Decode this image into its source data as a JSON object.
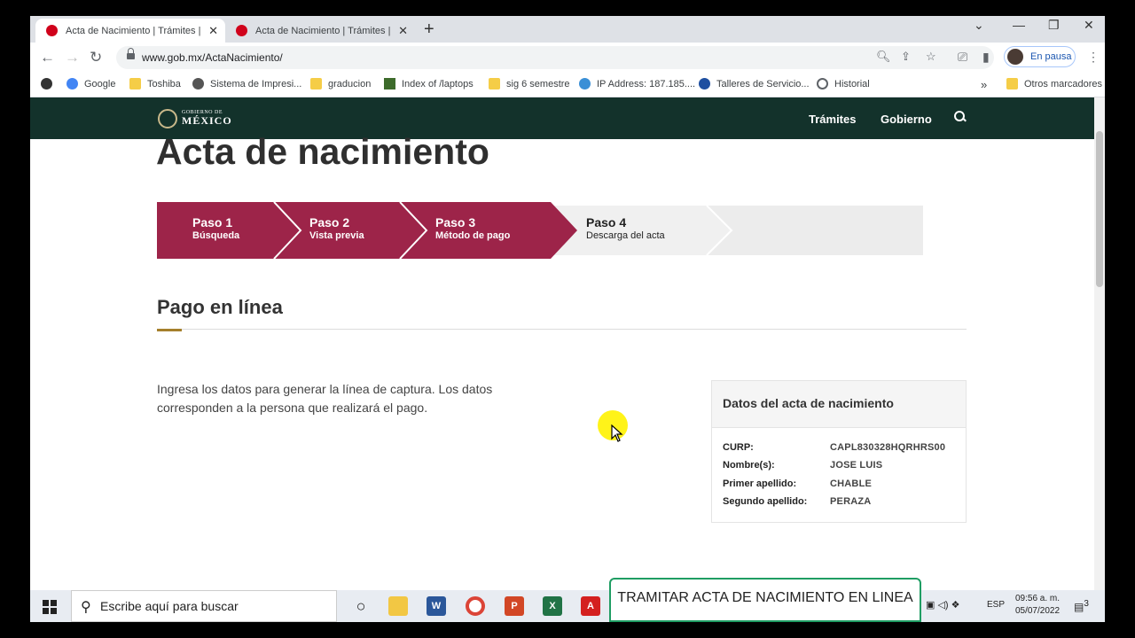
{
  "browser": {
    "tabs": [
      {
        "title": "Acta de Nacimiento | Trámites | g",
        "active": true
      },
      {
        "title": "Acta de Nacimiento | Trámites | g",
        "active": false
      }
    ],
    "url": "www.gob.mx/ActaNacimiento/",
    "profile_label": "En pausa",
    "bookmarks": [
      "Google",
      "Toshiba",
      "Sistema de Impresi...",
      "graducion",
      "Index of /laptops",
      "sig 6 semestre",
      "IP Address: 187.185....",
      "Talleres de Servicio...",
      "Historial"
    ],
    "other_bookmarks": "Otros marcadores",
    "more_chevron": "»"
  },
  "site": {
    "logo_top": "GOBIERNO DE",
    "logo_bottom": "MÉXICO",
    "menu": [
      "Trámites",
      "Gobierno"
    ]
  },
  "page": {
    "title": "Acta de nacimiento",
    "steps": [
      {
        "name": "Paso 1",
        "desc": "Búsqueda",
        "state": "done"
      },
      {
        "name": "Paso 2",
        "desc": "Vista previa",
        "state": "done"
      },
      {
        "name": "Paso 3",
        "desc": "Método de pago",
        "state": "current"
      },
      {
        "name": "Paso 4",
        "desc": "Descarga del acta",
        "state": "pending"
      }
    ],
    "section_title": "Pago en línea",
    "intro": "Ingresa los datos para generar la línea de captura. Los datos corresponden a la persona que realizará el pago.",
    "panel": {
      "title": "Datos del acta de nacimiento",
      "rows": [
        {
          "label": "CURP:",
          "value": "CAPL830328HQRHRS00"
        },
        {
          "label": "Nombre(s):",
          "value": "JOSE LUIS"
        },
        {
          "label": "Primer apellido:",
          "value": "CHABLE"
        },
        {
          "label": "Segundo apellido:",
          "value": "PERAZA"
        }
      ]
    }
  },
  "taskbar": {
    "search_placeholder": "Escribe aquí para buscar",
    "language": "ESP",
    "time": "09:56 a. m.",
    "date": "05/07/2022",
    "notification_count": "3"
  },
  "overlay_banner": "TRAMITAR ACTA DE NACIMIENTO EN LINEA",
  "colors": {
    "gob_green": "#13322b",
    "step_red": "#9d2449",
    "step_grey": "#f0f0f0",
    "accent_gold": "#a57f2c"
  }
}
